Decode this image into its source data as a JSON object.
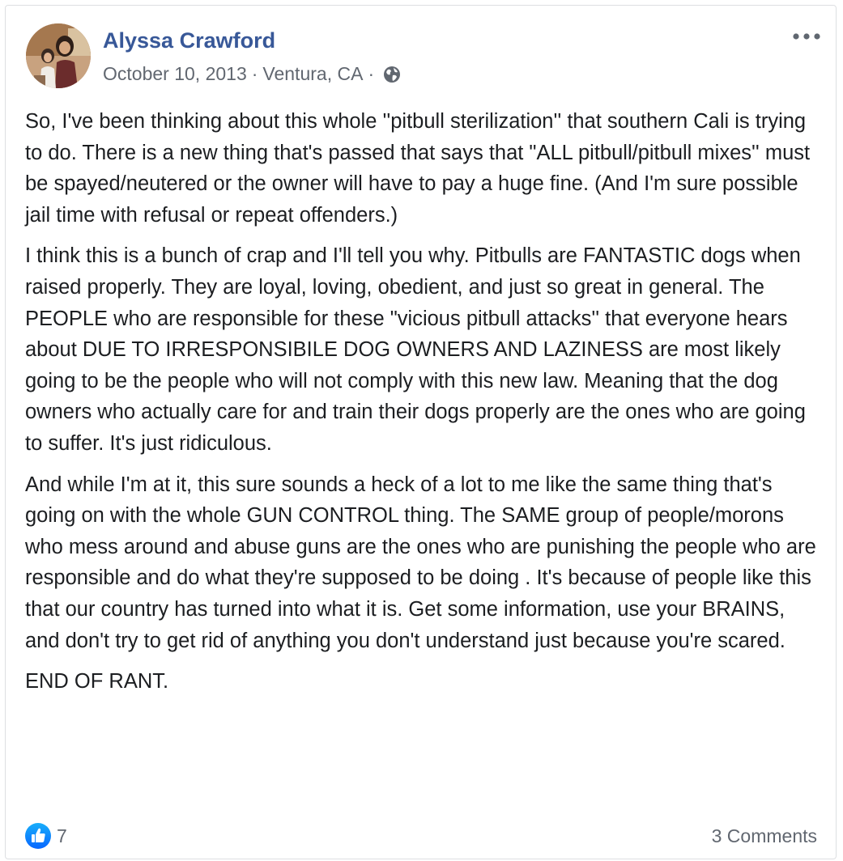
{
  "post": {
    "author_name": "Alyssa Crawford",
    "date": "October 10, 2013",
    "separator": "·",
    "location": "Ventura, CA",
    "paragraphs": [
      "So, I've been thinking about this whole ''pitbull sterilization'' that southern Cali is trying to do. There is a new thing that's passed that says that \"ALL pitbull/pitbull mixes'' must be spayed/neutered or the owner will have to pay a huge fine. (And I'm sure possible jail time with refusal or repeat offenders.)",
      "I think this is a bunch of crap and I'll tell you why. Pitbulls are FANTASTIC dogs when raised properly. They are loyal, loving, obedient, and just so great in general. The PEOPLE who are responsible for these \"vicious pitbull attacks'' that everyone hears about DUE TO IRRESPONSIBILE DOG OWNERS AND LAZINESS are most likely going to be the people who will not comply with this new law. Meaning that the dog owners who actually care for and train their dogs properly are the ones who are going to suffer. It's just ridiculous.",
      "And while I'm at it, this sure sounds a heck of a lot to me like the same thing that's going on with the whole GUN CONTROL thing. The SAME group of people/morons who mess around and abuse guns are the ones who are punishing the people who are responsible and do what they're supposed to be doing . It's because of people like this that our country has turned into what it is. Get some information, use your BRAINS, and don't try to get rid of anything you don't understand just because you're scared.",
      "END OF RANT."
    ],
    "like_count": "7",
    "comments_label": "3 Comments"
  },
  "icons": {
    "audience": "globe-icon",
    "menu": "more-options-icon",
    "reaction": "like-icon"
  },
  "colors": {
    "author_link": "#385898",
    "meta_text": "#616770",
    "body_text": "#1c1e21",
    "like_blue": "#1877f2"
  }
}
